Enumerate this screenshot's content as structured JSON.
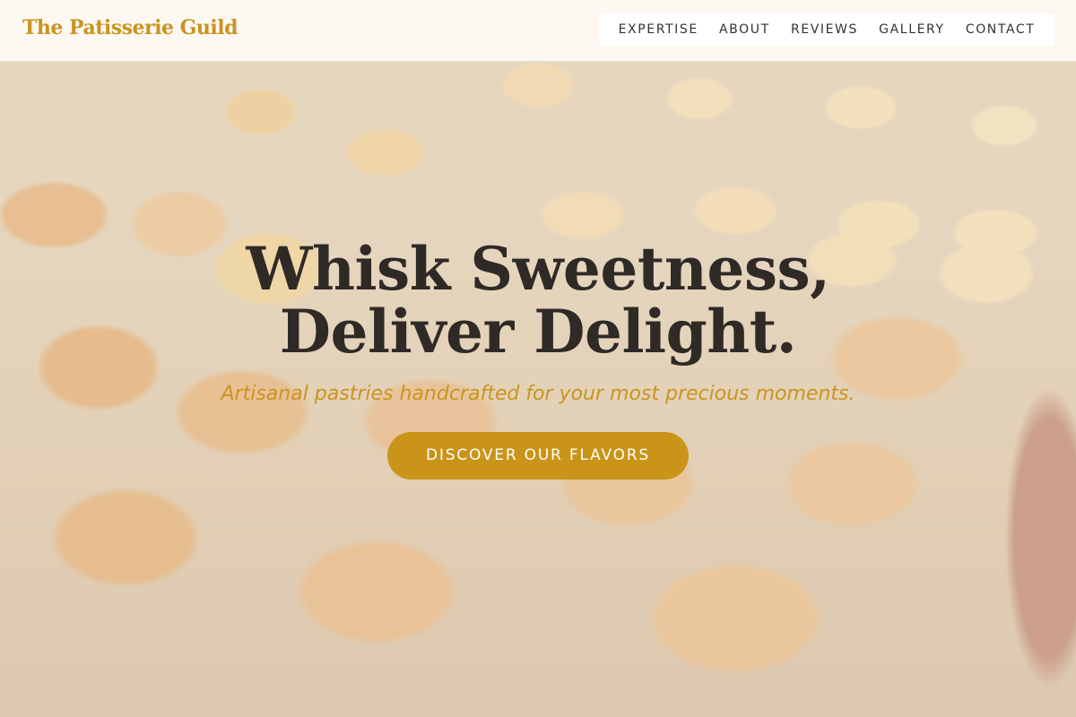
{
  "brand": {
    "name": "The Patisserie Guild"
  },
  "nav": {
    "items": [
      {
        "label": "EXPERTISE"
      },
      {
        "label": "ABOUT"
      },
      {
        "label": "REVIEWS"
      },
      {
        "label": "GALLERY"
      },
      {
        "label": "CONTACT"
      }
    ]
  },
  "hero": {
    "title_line1": "Whisk Sweetness,",
    "title_line2": "Deliver Delight.",
    "subtitle": "Artisanal pastries handcrafted for your most precious moments.",
    "cta_label": "DISCOVER OUR FLAVORS",
    "background_image": "pastry-tray-photo"
  },
  "colors": {
    "brand_gold": "#c99420",
    "button_gold": "#c99418",
    "heading_dark": "#2f2a26",
    "nav_text": "#333333"
  }
}
